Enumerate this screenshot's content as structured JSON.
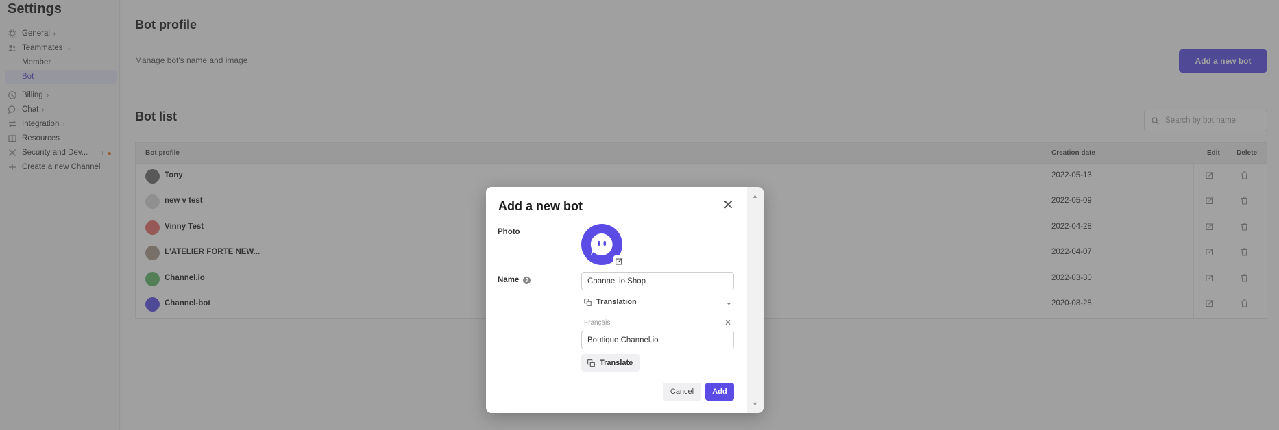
{
  "sidebar": {
    "title": "Settings",
    "items": [
      {
        "label": "General",
        "icon": "gear-icon"
      },
      {
        "label": "Teammates",
        "icon": "people-icon"
      },
      {
        "label": "Member"
      },
      {
        "label": "Bot"
      },
      {
        "label": "Billing",
        "icon": "dollar-icon"
      },
      {
        "label": "Chat",
        "icon": "chat-icon"
      },
      {
        "label": "Integration",
        "icon": "arrows-icon"
      },
      {
        "label": "Resources",
        "icon": "book-icon"
      },
      {
        "label": "Security and Dev...",
        "icon": "tools-icon"
      },
      {
        "label": "Create a new Channel",
        "icon": "plus-icon"
      }
    ]
  },
  "main": {
    "profile_title": "Bot profile",
    "profile_subtitle": "Manage bot's name and image",
    "add_button": "Add a new bot",
    "list_title": "Bot list",
    "search_placeholder": "Search by bot name",
    "columns": [
      "Bot profile",
      "Creation date",
      "Edit",
      "Delete"
    ],
    "rows": [
      {
        "name": "Tony",
        "date": "2022-05-13",
        "avatar_color": "#6b6b6b"
      },
      {
        "name": "new v test",
        "date": "2022-05-09",
        "avatar_color": "#d9d9d9"
      },
      {
        "name": "Vinny Test",
        "date": "2022-04-28",
        "avatar_color": "#e86b6b"
      },
      {
        "name": "L'ATELIER FORTE NEW...",
        "date": "2022-04-07",
        "avatar_color": "#a89a8a"
      },
      {
        "name": "Channel.io",
        "date": "2022-03-30",
        "avatar_color": "#5fb86a"
      },
      {
        "name": "Channel-bot",
        "date": "2020-08-28",
        "avatar_color": "#5b4ce6"
      }
    ]
  },
  "modal": {
    "title": "Add a new bot",
    "photo_label": "Photo",
    "name_label": "Name",
    "name_value": "Channel.io Shop",
    "translation_label": "Translation",
    "language": "Français",
    "translated_value": "Boutique Channel.io",
    "translate_button": "Translate",
    "cancel_button": "Cancel",
    "add_button": "Add"
  },
  "colors": {
    "accent": "#5b4ce6",
    "warning_dot": "#f07a24"
  }
}
